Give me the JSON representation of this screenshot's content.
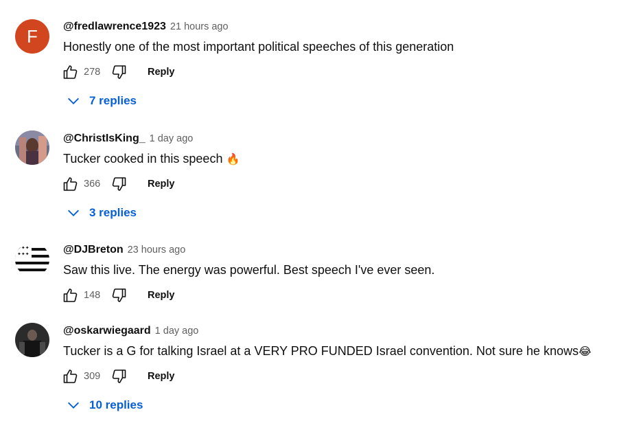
{
  "comments": [
    {
      "author": "@fredlawrence1923",
      "time": "21 hours ago",
      "avatar_letter": "F",
      "avatar_color": "#d2461f",
      "text": "Honestly one of the most important political speeches of this generation",
      "likes": "278",
      "reply_label": "Reply",
      "replies": "7 replies"
    },
    {
      "author": "@ChristIsKing_",
      "time": "1 day ago",
      "text": "Tucker cooked in this speech",
      "emoji": "🔥",
      "likes": "366",
      "reply_label": "Reply",
      "replies": "3 replies"
    },
    {
      "author": "@DJBreton",
      "time": "23 hours ago",
      "text": "Saw this live. The energy was powerful. Best speech I've ever seen.",
      "likes": "148",
      "reply_label": "Reply"
    },
    {
      "author": "@oskarwiegaard",
      "time": "1 day ago",
      "text": "Tucker is a G for talking Israel at a VERY PRO FUNDED Israel convention. Not sure he knows",
      "emoji": "😂",
      "likes": "309",
      "reply_label": "Reply",
      "replies": "10 replies"
    }
  ],
  "colors": {
    "link_blue": "#065fd4",
    "meta_gray": "#606060"
  }
}
